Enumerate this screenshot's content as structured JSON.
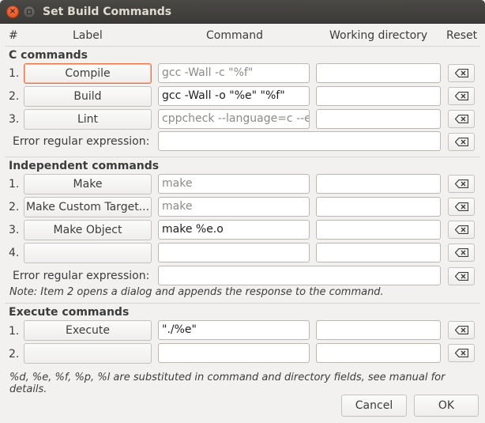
{
  "window": {
    "title": "Set Build Commands"
  },
  "headers": {
    "num": "#",
    "label": "Label",
    "command": "Command",
    "workdir": "Working directory",
    "reset": "Reset"
  },
  "c_section": {
    "title": "C commands",
    "rows": [
      {
        "num": "1.",
        "label": "Compile",
        "command": "gcc -Wall -c \"%f\"",
        "workdir": ""
      },
      {
        "num": "2.",
        "label": "Build",
        "command": "gcc -Wall -o \"%e\" \"%f\"",
        "workdir": ""
      },
      {
        "num": "3.",
        "label": "Lint",
        "command": "cppcheck --language=c --enable=warning,style",
        "workdir": ""
      }
    ],
    "error_label": "Error regular expression:",
    "error_value": ""
  },
  "ind_section": {
    "title": "Independent commands",
    "rows": [
      {
        "num": "1.",
        "label": "Make",
        "command": "make",
        "workdir": ""
      },
      {
        "num": "2.",
        "label": "Make Custom Target...",
        "command": "make",
        "workdir": ""
      },
      {
        "num": "3.",
        "label": "Make Object",
        "command": "make %e.o",
        "workdir": ""
      },
      {
        "num": "4.",
        "label": "",
        "command": "",
        "workdir": ""
      }
    ],
    "error_label": "Error regular expression:",
    "error_value": "",
    "note": "Note: Item 2 opens a dialog and appends the response to the command."
  },
  "exec_section": {
    "title": "Execute commands",
    "rows": [
      {
        "num": "1.",
        "label": "Execute",
        "command": "\"./%e\"",
        "workdir": ""
      },
      {
        "num": "2.",
        "label": "",
        "command": "",
        "workdir": ""
      }
    ]
  },
  "footer_note": "%d, %e, %f, %p, %l are substituted in command and directory fields, see manual for details.",
  "buttons": {
    "cancel": "Cancel",
    "ok": "OK"
  }
}
